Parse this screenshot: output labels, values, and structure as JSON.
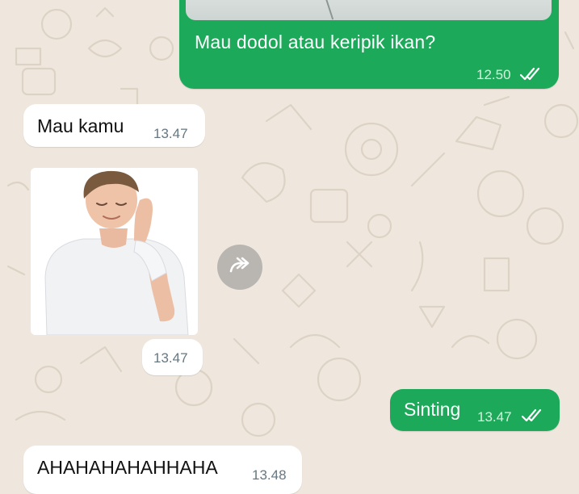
{
  "theme": {
    "wallpaper": "#efe7dd",
    "outgoing": "#1da95a",
    "incoming": "#ffffff"
  },
  "messages": [
    {
      "direction": "outgoing",
      "text": "Mau dodol atau keripik ikan?",
      "time": "12.50",
      "status": "read"
    },
    {
      "direction": "incoming",
      "text": "Mau kamu",
      "time": "13.47"
    },
    {
      "direction": "incoming",
      "type": "sticker",
      "time": "13.47",
      "icon": "forward-icon"
    },
    {
      "direction": "outgoing",
      "text": "Sinting",
      "time": "13.47",
      "status": "read"
    },
    {
      "direction": "incoming",
      "text": "AHAHAHAHAHHAHA",
      "time": "13.48"
    }
  ]
}
